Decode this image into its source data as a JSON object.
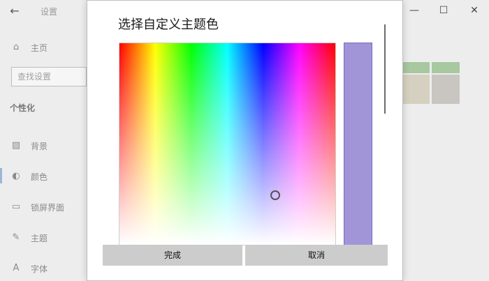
{
  "settings": {
    "title": "设置",
    "back_icon": "←",
    "nav": {
      "home": "主页",
      "search_placeholder": "查找设置",
      "section": "个性化",
      "items": [
        {
          "label": "背景",
          "icon": "▨"
        },
        {
          "label": "颜色",
          "icon": "◐"
        },
        {
          "label": "锁屏界面",
          "icon": "▭"
        },
        {
          "label": "主题",
          "icon": "✎"
        },
        {
          "label": "字体",
          "icon": "A"
        }
      ]
    },
    "window_controls": {
      "minimize": "—",
      "maximize": "☐",
      "close": "✕"
    }
  },
  "dialog": {
    "title": "选择自定义主题色",
    "selected_color": "#a195d8",
    "done_label": "完成",
    "cancel_label": "取消"
  },
  "colors": {
    "accent_preview": "#a195d8",
    "tile_green": "#a8c8a0",
    "tile_beige": "#d6d0c0",
    "tile_gray": "#c9c6c2"
  }
}
